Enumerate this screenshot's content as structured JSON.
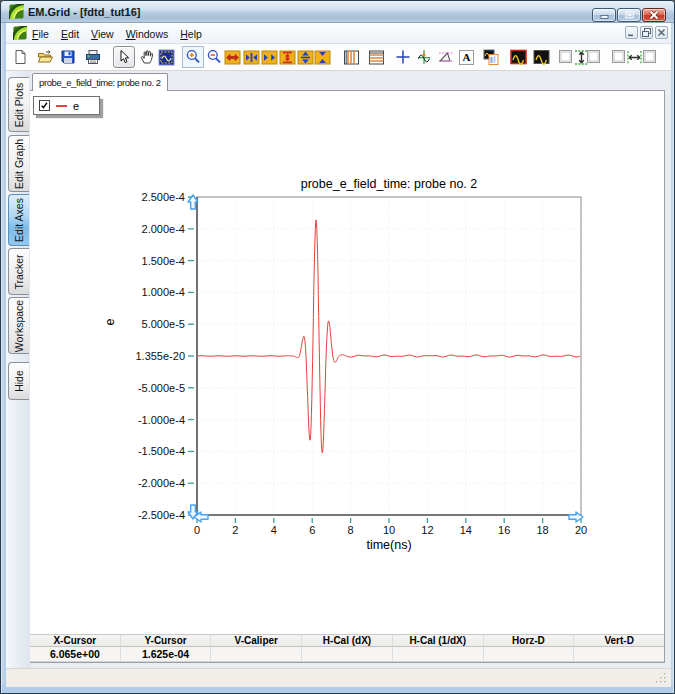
{
  "window": {
    "title": "EM.Grid - [fdtd_tut16]",
    "buttons": [
      "Minimize",
      "Maximize",
      "Close"
    ]
  },
  "menu": {
    "items": [
      "File",
      "Edit",
      "View",
      "Windows",
      "Help"
    ]
  },
  "mdi_buttons": [
    "Minimize",
    "Restore",
    "Close"
  ],
  "toolbar": {
    "buttons": [
      {
        "icon": "new-file-icon",
        "name": "new-button"
      },
      {
        "icon": "open-folder-icon",
        "name": "open-button"
      },
      {
        "icon": "save-icon",
        "name": "save-button"
      },
      {
        "icon": "print-icon",
        "name": "print-button"
      },
      {
        "icon": "pointer-icon",
        "name": "select-pointer-button",
        "state": "active"
      },
      {
        "icon": "pan-hand-icon",
        "name": "pan-button"
      },
      {
        "icon": "zoom-rect-icon",
        "name": "zoom-rect-button"
      },
      {
        "icon": "zoom-in-icon",
        "name": "zoom-in-button",
        "state": "hover"
      },
      {
        "icon": "zoom-out-icon",
        "name": "zoom-out-button"
      },
      {
        "icon": "expand-x-icon",
        "name": "expand-x-button"
      },
      {
        "icon": "shrink-x-icon",
        "name": "shrink-x-button"
      },
      {
        "icon": "compress-x-icon",
        "name": "compress-x-button"
      },
      {
        "icon": "expand-y-icon",
        "name": "expand-y-button"
      },
      {
        "icon": "shrink-y-icon",
        "name": "shrink-y-button"
      },
      {
        "icon": "compress-y-icon",
        "name": "compress-y-button"
      },
      {
        "icon": "vertical-grid-icon",
        "name": "vertical-grid-button"
      },
      {
        "icon": "horizontal-grid-icon",
        "name": "horizontal-grid-button"
      },
      {
        "icon": "crosshair-icon",
        "name": "crosshair-button"
      },
      {
        "icon": "tracker-icon",
        "name": "tracker-button"
      },
      {
        "icon": "slope-caliper-icon",
        "name": "slope-caliper-button"
      },
      {
        "icon": "text-label-icon",
        "name": "text-label-button"
      },
      {
        "icon": "copy-plot-icon",
        "name": "copy-plot-button"
      },
      {
        "icon": "dark-plot-red-icon",
        "name": "dark-plot-button"
      },
      {
        "icon": "dark-plot-icon",
        "name": "dark-plot-alt-button"
      },
      {
        "icon": "checkbox-icon",
        "name": "v-caliper-left-checkbox"
      },
      {
        "icon": "v-caliper-icon",
        "name": "v-caliper-arrows"
      },
      {
        "icon": "checkbox-icon",
        "name": "v-caliper-right-checkbox"
      },
      {
        "icon": "checkbox-icon",
        "name": "h-caliper-left-checkbox"
      },
      {
        "icon": "h-caliper-icon",
        "name": "h-caliper-arrows"
      },
      {
        "icon": "checkbox-icon",
        "name": "h-caliper-right-checkbox"
      }
    ]
  },
  "sidebar": {
    "tabs": [
      {
        "label": "Edit Plots"
      },
      {
        "label": "Edit Graph"
      },
      {
        "label": "Edit Axes",
        "active": true
      },
      {
        "label": "Tracker"
      },
      {
        "label": "Workspace"
      },
      {
        "label": "Hide"
      }
    ]
  },
  "doc_tab": {
    "label": "probe_e_field_time: probe no. 2"
  },
  "legend": {
    "checked": true,
    "label": "e",
    "swatch_color": "#e84040"
  },
  "chart_data": {
    "type": "line",
    "title": "probe_e_field_time: probe no. 2",
    "xlabel": "time(ns)",
    "ylabel": "e",
    "xlim": [
      0,
      20
    ],
    "ylim_scaled": [
      -2.5,
      2.5
    ],
    "y_scale": 0.0001,
    "x_ticks": [
      0,
      2,
      4,
      6,
      8,
      10,
      12,
      14,
      16,
      18,
      20
    ],
    "y_tick_labels": [
      "2.500e-4",
      "2.000e-4",
      "1.500e-4",
      "1.000e-4",
      "5.000e-5",
      "1.355e-20",
      "-5.000e-5",
      "-1.000e-4",
      "-1.500e-4",
      "-2.000e-4",
      "-2.500e-4"
    ],
    "grid": "dotted",
    "legend_position": "top-left",
    "series": [
      {
        "name": "e",
        "color": "#e84040",
        "x": [
          0.0,
          0.2,
          0.4,
          0.6,
          0.8,
          1.0,
          1.2,
          1.4,
          1.6,
          1.8,
          2.0,
          2.2,
          2.4,
          2.6,
          2.8,
          3.0,
          3.2,
          3.4,
          3.6,
          3.8,
          4.0,
          4.2,
          4.4,
          4.6,
          4.62,
          4.64,
          4.66,
          4.68,
          4.7,
          4.72,
          4.74,
          4.76,
          4.78,
          4.8,
          4.82,
          4.84,
          4.86,
          4.88,
          4.9,
          4.92,
          4.94,
          4.96,
          4.98,
          5.0,
          5.02,
          5.04,
          5.06,
          5.08,
          5.1,
          5.12,
          5.14,
          5.16,
          5.18,
          5.2,
          5.22,
          5.24,
          5.26,
          5.28,
          5.3,
          5.32,
          5.34,
          5.36,
          5.38,
          5.4,
          5.42,
          5.44,
          5.46,
          5.48,
          5.5,
          5.52,
          5.54,
          5.56,
          5.58,
          5.6,
          5.62,
          5.64,
          5.66,
          5.68,
          5.7,
          5.72,
          5.74,
          5.76,
          5.78,
          5.8,
          5.82,
          5.84,
          5.86,
          5.88,
          5.9,
          5.92,
          5.94,
          5.96,
          5.98,
          6.0,
          6.02,
          6.04,
          6.06,
          6.08,
          6.1,
          6.12,
          6.14,
          6.16,
          6.18,
          6.2,
          6.22,
          6.24,
          6.26,
          6.28,
          6.3,
          6.32,
          6.34,
          6.36,
          6.38,
          6.4,
          6.42,
          6.44,
          6.46,
          6.48,
          6.5,
          6.52,
          6.54,
          6.56,
          6.58,
          6.6,
          6.62,
          6.64,
          6.66,
          6.68,
          6.7,
          6.72,
          6.74,
          6.76,
          6.78,
          6.8,
          6.82,
          6.84,
          6.86,
          6.88,
          6.9,
          6.92,
          6.94,
          6.96,
          6.98,
          7.0,
          7.02,
          7.04,
          7.06,
          7.08,
          7.1,
          7.12,
          7.14,
          7.16,
          7.18,
          7.2,
          7.22,
          7.24,
          7.26,
          7.28,
          7.3,
          7.32,
          7.34,
          7.36,
          7.38,
          7.4,
          7.42,
          7.44,
          7.46,
          7.48,
          7.5,
          7.52,
          7.54,
          7.56,
          7.58,
          7.6,
          7.62,
          7.64,
          7.66,
          7.68,
          7.7,
          7.72,
          7.74,
          7.76,
          7.78,
          7.8,
          7.82,
          7.94,
          8.06,
          8.18,
          8.3,
          8.42,
          8.54,
          8.66,
          8.78,
          8.9,
          9.02,
          9.14,
          9.26,
          9.38,
          9.5,
          9.62,
          9.74,
          9.86,
          9.98,
          10.1,
          10.22,
          10.34,
          10.46,
          10.58,
          10.7,
          10.82,
          10.94,
          11.06,
          11.18,
          11.3,
          11.42,
          11.54,
          11.66,
          11.78,
          11.9,
          12.02,
          12.14,
          12.26,
          12.38,
          12.5,
          12.62,
          12.74,
          12.86,
          12.98,
          13.1,
          13.22,
          13.34,
          13.46,
          13.58,
          13.7,
          13.82,
          13.94,
          14.06,
          14.18,
          14.3,
          14.42,
          14.54,
          14.66,
          14.78,
          14.9,
          15.02,
          15.14,
          15.26,
          15.38,
          15.5,
          15.62,
          15.74,
          15.86,
          15.98,
          16.1,
          16.22,
          16.34,
          16.46,
          16.58,
          16.7,
          16.82,
          16.94,
          17.06,
          17.18,
          17.3,
          17.42,
          17.54,
          17.66,
          17.78,
          17.9,
          18.02,
          18.14,
          18.26,
          18.38,
          18.5,
          18.62,
          18.74,
          18.86,
          18.98,
          19.1,
          19.22,
          19.34,
          19.46,
          19.58,
          19.7,
          19.82,
          19.94
        ],
        "y_e4": [
          0.0,
          0.004,
          0.001,
          -0.003,
          -0.003,
          0.003,
          0.003,
          -0.001,
          -0.004,
          0.0,
          0.004,
          0.001,
          -0.004,
          -0.002,
          0.003,
          0.003,
          -0.002,
          -0.004,
          0.0,
          0.004,
          0.001,
          -0.004,
          -0.002,
          0.003,
          0.003,
          0.004,
          0.004,
          0.004,
          0.004,
          0.004,
          0.004,
          0.004,
          0.004,
          0.004,
          0.001,
          0.001,
          0.001,
          0.001,
          0.001,
          0.001,
          0.001,
          0.0,
          -0.0,
          -0.001,
          -0.002,
          -0.003,
          -0.005,
          -0.007,
          -0.01,
          -0.013,
          -0.016,
          -0.02,
          -0.023,
          -0.025,
          -0.027,
          -0.027,
          -0.026,
          -0.022,
          -0.015,
          -0.004,
          0.011,
          0.03,
          0.054,
          0.082,
          0.114,
          0.149,
          0.186,
          0.222,
          0.255,
          0.283,
          0.303,
          0.312,
          0.305,
          0.282,
          0.238,
          0.172,
          0.084,
          -0.027,
          -0.158,
          -0.306,
          -0.468,
          -0.636,
          -0.803,
          -0.961,
          -1.101,
          -1.214,
          -1.291,
          -1.324,
          -1.306,
          -1.234,
          -1.106,
          -0.921,
          -0.685,
          -0.403,
          -0.086,
          0.254,
          0.605,
          0.951,
          1.276,
          1.566,
          1.808,
          1.989,
          2.102,
          2.14,
          2.103,
          1.994,
          1.817,
          1.58,
          1.294,
          0.97,
          0.621,
          0.263,
          -0.09,
          -0.426,
          -0.732,
          -0.997,
          -1.213,
          -1.374,
          -1.477,
          -1.523,
          -1.512,
          -1.45,
          -1.342,
          -1.196,
          -1.022,
          -0.828,
          -0.625,
          -0.42,
          -0.222,
          -0.039,
          0.125,
          0.264,
          0.377,
          0.461,
          0.517,
          0.546,
          0.55,
          0.533,
          0.499,
          0.45,
          0.392,
          0.329,
          0.262,
          0.197,
          0.136,
          0.079,
          0.03,
          -0.011,
          -0.044,
          -0.069,
          -0.086,
          -0.096,
          -0.1,
          -0.099,
          -0.094,
          -0.086,
          -0.075,
          -0.064,
          -0.053,
          -0.039,
          -0.028,
          -0.018,
          -0.009,
          -0.001,
          0.005,
          0.01,
          0.014,
          0.017,
          0.019,
          0.02,
          0.02,
          0.02,
          0.019,
          0.018,
          0.016,
          0.015,
          0.013,
          0.011,
          0.008,
          0.006,
          0.004,
          0.002,
          -0.001,
          -0.003,
          -0.005,
          -0.016,
          -0.016,
          -0.006,
          0.006,
          0.012,
          0.008,
          0.003,
          0.001,
          0.002,
          0.001,
          -0.005,
          -0.012,
          -0.012,
          -0.003,
          0.01,
          0.017,
          0.012,
          0.0,
          -0.008,
          -0.009,
          -0.005,
          -0.002,
          -0.004,
          -0.004,
          0.001,
          0.01,
          0.015,
          0.01,
          -0.003,
          -0.014,
          -0.015,
          -0.007,
          0.003,
          0.007,
          0.005,
          0.003,
          0.005,
          0.007,
          0.004,
          -0.005,
          -0.014,
          -0.015,
          -0.005,
          0.008,
          0.015,
          0.011,
          0.002,
          -0.003,
          -0.003,
          -0.002,
          -0.004,
          -0.009,
          -0.009,
          -0.001,
          0.01,
          0.017,
          0.012,
          -0.001,
          -0.011,
          -0.012,
          -0.006,
          -0.0,
          0.001,
          0.0,
          0.002,
          0.008,
          0.012,
          0.008,
          -0.004,
          -0.015,
          -0.016,
          -0.007,
          0.005,
          0.011,
          0.008,
          0.003,
          0.001,
          0.002,
          0.001,
          -0.005,
          -0.012,
          -0.013,
          -0.004,
          0.009,
          0.017,
          0.012,
          0.001,
          -0.007,
          -0.008,
          -0.005,
          -0.003,
          -0.004,
          -0.005,
          0.0,
          0.01,
          0.015,
          0.011,
          -0.002,
          -0.013,
          -0.015,
          -0.007
        ]
      }
    ]
  },
  "cursor_table": {
    "headers": [
      "X-Cursor",
      "Y-Cursor",
      "V-Caliper",
      "H-Cal (dX)",
      "H-Cal (1/dX)",
      "Horz-D",
      "Vert-D"
    ],
    "values": [
      "6.065e+00",
      "1.625e-04",
      "",
      "",
      "",
      "",
      ""
    ]
  },
  "colors": {
    "accent_selection": "#79b9e8",
    "curve": "#e84040",
    "tick": "#3d9e9e",
    "handle": "#4aa3f0"
  }
}
